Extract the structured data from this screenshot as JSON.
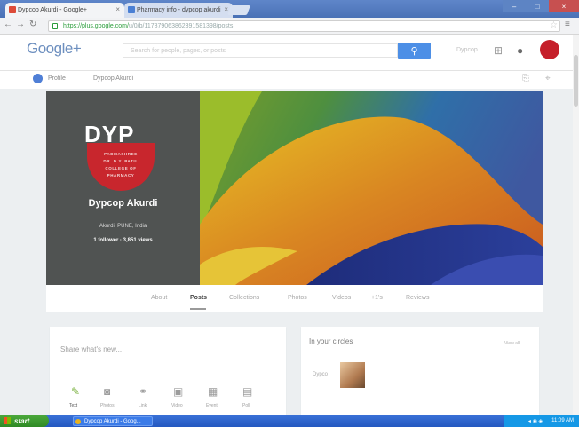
{
  "browser": {
    "tabs": [
      {
        "title": "Dypcop Akurdi - Google+",
        "favicon_color": "#dd4b39"
      },
      {
        "title": "Pharmacy info - dypcop akurdi",
        "favicon_color": "#4a7fd4"
      }
    ],
    "address": "https://plus.google.com/",
    "address_rest": "u/0/b/117879063862391581398/posts"
  },
  "gplus": {
    "logo": "Google+",
    "search_placeholder": "Search for people, pages, or posts",
    "header_link": "Dypcop",
    "nav_left": "Profile",
    "nav_right": "Dypcop Akurdi"
  },
  "profile": {
    "logo_letters": "DYP",
    "logo_lines": [
      "PADMASHREE",
      "DR. D.Y. PATIL",
      "COLLEGE OF",
      "PHARMACY"
    ],
    "name": "Dypcop Akurdi",
    "location": "Akurdi, PUNE, India",
    "stats": "1 follower · 3,851 views"
  },
  "tabs": [
    "About",
    "Posts",
    "Collections",
    "Photos",
    "Videos",
    "+1's",
    "Reviews"
  ],
  "active_tab": "Posts",
  "share": {
    "prompt": "Share what's new...",
    "actions": [
      "Text",
      "Photos",
      "Link",
      "Video",
      "Event",
      "Poll"
    ]
  },
  "circles": {
    "title": "In your circles",
    "view_all": "View all",
    "member_label": "Dypco"
  },
  "taskbar": {
    "start": "start",
    "item": "Dypcop Akurdi - Goog...",
    "clock": "11:09 AM"
  },
  "colors": {
    "accent": "#4d8fe6",
    "brand_red": "#c8262d",
    "cover_dark": "#505352"
  }
}
